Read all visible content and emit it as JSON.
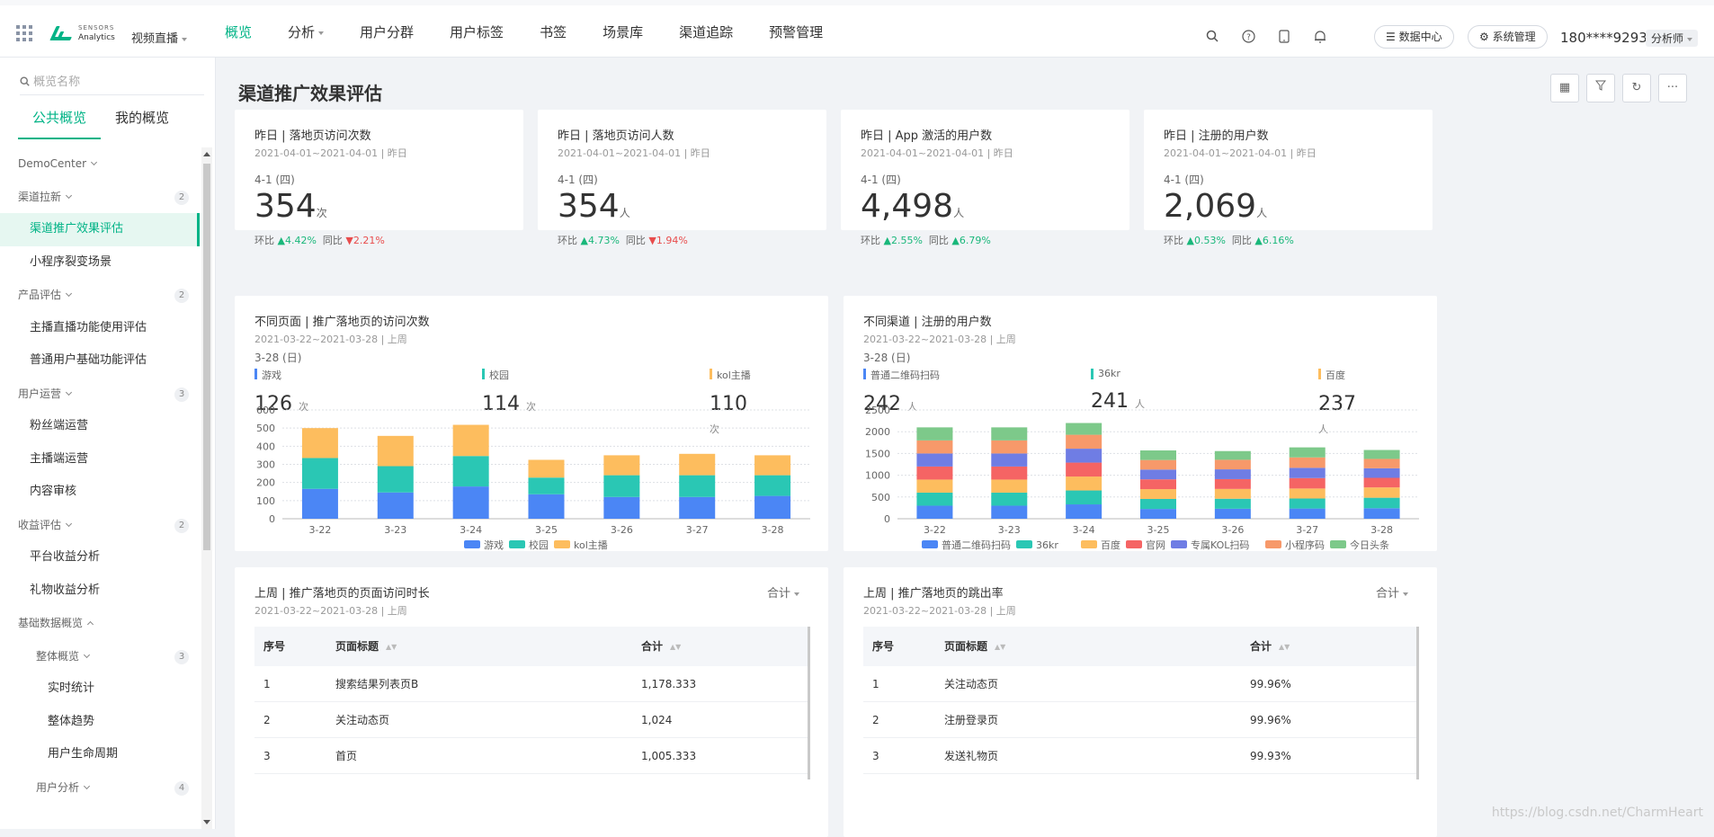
{
  "topbar": {
    "logo_line1": "SENSORS",
    "logo_line2": "Analytics",
    "project": "视频直播",
    "nav": [
      {
        "label": "概览",
        "active": true
      },
      {
        "label": "分析",
        "dropdown": true
      },
      {
        "label": "用户分群"
      },
      {
        "label": "用户标签"
      },
      {
        "label": "书签"
      },
      {
        "label": "场景库"
      },
      {
        "label": "渠道追踪"
      },
      {
        "label": "预警管理"
      }
    ],
    "data_center": "数据中心",
    "system_manage": "系统管理",
    "user": "180****9293",
    "role": "分析师"
  },
  "sidebar": {
    "search_placeholder": "概览名称",
    "tabs": [
      "公共概览",
      "我的概览"
    ],
    "items": [
      {
        "label": "DemoCenter",
        "type": "grp"
      },
      {
        "label": "渠道拉新",
        "type": "grp",
        "badge": "2"
      },
      {
        "label": "渠道推广效果评估",
        "type": "item",
        "selected": true
      },
      {
        "label": "小程序裂变场景",
        "type": "item"
      },
      {
        "label": "产品评估",
        "type": "grp",
        "badge": "2"
      },
      {
        "label": "主播直播功能使用评估",
        "type": "item"
      },
      {
        "label": "普通用户基础功能评估",
        "type": "item"
      },
      {
        "label": "用户运营",
        "type": "grp",
        "badge": "3"
      },
      {
        "label": "粉丝端运营",
        "type": "item"
      },
      {
        "label": "主播端运营",
        "type": "item"
      },
      {
        "label": "内容审核",
        "type": "item"
      },
      {
        "label": "收益评估",
        "type": "grp",
        "badge": "2"
      },
      {
        "label": "平台收益分析",
        "type": "item"
      },
      {
        "label": "礼物收益分析",
        "type": "item"
      },
      {
        "label": "基础数据概览",
        "type": "grp",
        "open": true
      },
      {
        "label": "整体概览",
        "type": "sub",
        "badge": "3"
      },
      {
        "label": "实时统计",
        "type": "subitem"
      },
      {
        "label": "整体趋势",
        "type": "subitem"
      },
      {
        "label": "用户生命周期",
        "type": "subitem"
      },
      {
        "label": "用户分析",
        "type": "sub",
        "badge": "4"
      }
    ]
  },
  "page": {
    "title": "渠道推广效果评估"
  },
  "kpis": [
    {
      "title": "昨日 | 落地页访问次数",
      "range": "2021-04-01~2021-04-01 | 昨日",
      "date": "4-1 (四)",
      "value": "354",
      "unit": "次",
      "ring_label": "环比",
      "ring": "4.42%",
      "ring_dir": "up",
      "yoy_label": "同比",
      "yoy": "2.21%",
      "yoy_dir": "down"
    },
    {
      "title": "昨日 | 落地页访问人数",
      "range": "2021-04-01~2021-04-01 | 昨日",
      "date": "4-1 (四)",
      "value": "354",
      "unit": "人",
      "ring_label": "环比",
      "ring": "4.73%",
      "ring_dir": "up",
      "yoy_label": "同比",
      "yoy": "1.94%",
      "yoy_dir": "down"
    },
    {
      "title": "昨日 | App 激活的用户数",
      "range": "2021-04-01~2021-04-01 | 昨日",
      "date": "4-1 (四)",
      "value": "4,498",
      "unit": "人",
      "ring_label": "环比",
      "ring": "2.55%",
      "ring_dir": "up",
      "yoy_label": "同比",
      "yoy": "6.79%",
      "yoy_dir": "up"
    },
    {
      "title": "昨日 | 注册的用户数",
      "range": "2021-04-01~2021-04-01 | 昨日",
      "date": "4-1 (四)",
      "value": "2,069",
      "unit": "人",
      "ring_label": "环比",
      "ring": "0.53%",
      "ring_dir": "up",
      "yoy_label": "同比",
      "yoy": "6.16%",
      "yoy_dir": "up"
    }
  ],
  "charts": [
    {
      "title": "不同页面 | 推广落地页的访问次数",
      "range": "2021-03-22~2021-03-28 | 上周",
      "date": "3-28 (日)",
      "summary": [
        {
          "name": "游戏",
          "value": "126",
          "unit": "次",
          "color": "#4b86f5"
        },
        {
          "name": "校园",
          "value": "114",
          "unit": "次",
          "color": "#2ac7b4"
        },
        {
          "name": "kol主播",
          "value": "110",
          "unit": "次",
          "color": "#fdbd5e"
        }
      ]
    },
    {
      "title": "不同渠道 | 注册的用户数",
      "range": "2021-03-22~2021-03-28 | 上周",
      "date": "3-28 (日)",
      "summary": [
        {
          "name": "普通二维码扫码",
          "value": "242",
          "unit": "人",
          "color": "#4b86f5"
        },
        {
          "name": "36kr",
          "value": "241",
          "unit": "人",
          "color": "#2ac7b4"
        },
        {
          "name": "百度",
          "value": "237",
          "unit": "人",
          "color": "#fdbd5e"
        }
      ]
    }
  ],
  "chart_data": [
    {
      "type": "bar",
      "stacked": true,
      "categories": [
        "3-22",
        "3-23",
        "3-24",
        "3-25",
        "3-26",
        "3-27",
        "3-28"
      ],
      "ylim": [
        0,
        600
      ],
      "yticks": [
        0,
        100,
        200,
        300,
        400,
        500,
        600
      ],
      "legend_position": "bottom",
      "grid": true,
      "series": [
        {
          "name": "游戏",
          "color": "#4b86f5",
          "values": [
            165,
            145,
            178,
            135,
            120,
            120,
            126
          ]
        },
        {
          "name": "校园",
          "color": "#2ac7b4",
          "values": [
            170,
            145,
            168,
            92,
            120,
            120,
            114
          ]
        },
        {
          "name": "kol主播",
          "color": "#fdbd5e",
          "values": [
            165,
            167,
            172,
            98,
            110,
            118,
            110
          ]
        }
      ]
    },
    {
      "type": "bar",
      "stacked": true,
      "categories": [
        "3-22",
        "3-23",
        "3-24",
        "3-25",
        "3-26",
        "3-27",
        "3-28"
      ],
      "ylim": [
        0,
        2500
      ],
      "yticks": [
        0,
        500,
        1000,
        1500,
        2000,
        2500
      ],
      "legend_position": "bottom",
      "grid": true,
      "series": [
        {
          "name": "普通二维码扫码",
          "color": "#4b86f5",
          "values": [
            300,
            300,
            330,
            225,
            230,
            235,
            242
          ]
        },
        {
          "name": "36kr",
          "color": "#2ac7b4",
          "values": [
            300,
            300,
            320,
            230,
            230,
            230,
            241
          ]
        },
        {
          "name": "百度",
          "color": "#fdbd5e",
          "values": [
            300,
            300,
            320,
            225,
            225,
            230,
            237
          ]
        },
        {
          "name": "官网",
          "color": "#f56464",
          "values": [
            300,
            300,
            320,
            225,
            225,
            240,
            220
          ]
        },
        {
          "name": "专属KOL扫码",
          "color": "#6f7de4",
          "values": [
            300,
            300,
            320,
            225,
            225,
            235,
            220
          ]
        },
        {
          "name": "小程序码",
          "color": "#f7996a",
          "values": [
            300,
            300,
            320,
            220,
            220,
            240,
            215
          ]
        },
        {
          "name": "今日头条",
          "color": "#7dc98a",
          "values": [
            300,
            300,
            270,
            220,
            200,
            230,
            205
          ]
        }
      ]
    }
  ],
  "tables": [
    {
      "title": "上周 | 推广落地页的页面访问时长",
      "range": "2021-03-22~2021-03-28 | 上周",
      "agg": "合计",
      "headers": [
        "序号",
        "页面标题",
        "合计"
      ],
      "rows": [
        [
          "1",
          "搜索结果列表页B",
          "1,178.333"
        ],
        [
          "2",
          "关注动态页",
          "1,024"
        ],
        [
          "3",
          "首页",
          "1,005.333"
        ]
      ]
    },
    {
      "title": "上周 | 推广落地页的跳出率",
      "range": "2021-03-22~2021-03-28 | 上周",
      "agg": "合计",
      "headers": [
        "序号",
        "页面标题",
        "合计"
      ],
      "rows": [
        [
          "1",
          "关注动态页",
          "99.96%"
        ],
        [
          "2",
          "注册登录页",
          "99.96%"
        ],
        [
          "3",
          "发送礼物页",
          "99.93%"
        ]
      ]
    }
  ],
  "watermark": "https://blog.csdn.net/CharmHeart"
}
